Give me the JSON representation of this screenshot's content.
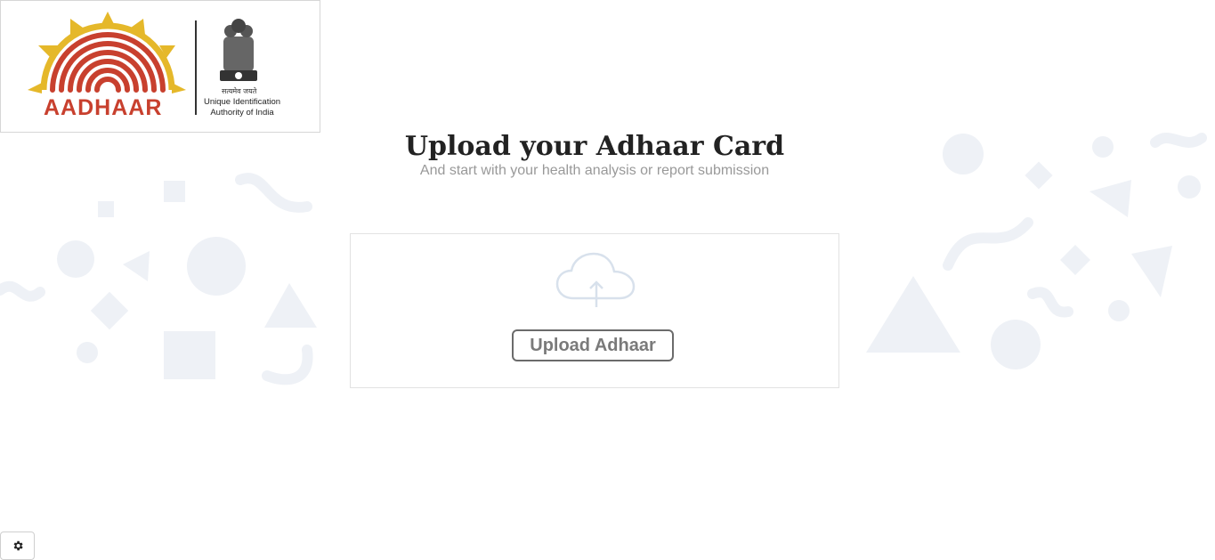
{
  "logo": {
    "brand_text": "AADHAAR",
    "motto": "सत्यमेव जयते",
    "authority_line1": "Unique Identification",
    "authority_line2": "Authority of India",
    "icons": [
      "aadhaar-fingerprint-icon",
      "national-emblem-icon"
    ]
  },
  "header": {
    "title": "Upload your Adhaar Card",
    "subtitle": "And start with your health analysis or report submission"
  },
  "upload": {
    "icon": "cloud-upload-icon",
    "button_label": "Upload Adhaar"
  },
  "settings": {
    "icon": "gear-icon"
  },
  "colors": {
    "brand_red": "#c8402e",
    "brand_yellow": "#e5b82a",
    "decor_shapes": "#eef1f6",
    "title_text": "#222222",
    "subtitle_text": "#999999",
    "button_border": "#6b6b6b"
  }
}
